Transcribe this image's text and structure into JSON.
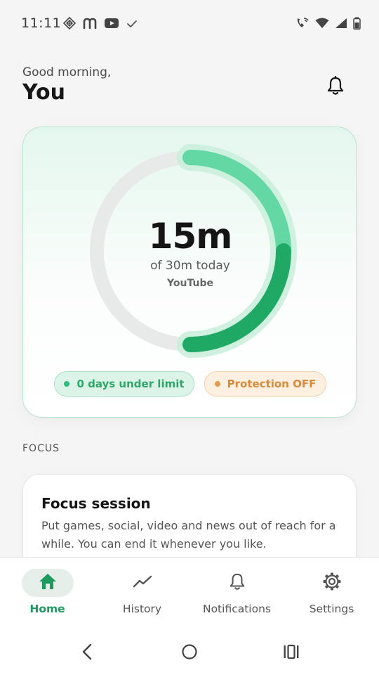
{
  "status_bar": {
    "time": "11:11",
    "left_icons": [
      "diamond-grid-icon",
      "m-app-icon",
      "youtube-icon",
      "check-icon"
    ],
    "right_icons": [
      "wifi-calling-icon",
      "wifi-icon",
      "signal-icon",
      "battery-icon"
    ]
  },
  "header": {
    "greeting": "Good morning,",
    "name": "You",
    "notification_icon": "bell-icon"
  },
  "usage": {
    "value": "15m",
    "subtitle": "of 30m today",
    "app": "YouTube",
    "progress_fraction": 0.5,
    "streak_pill": "0 days under limit",
    "protection_pill": "Protection OFF",
    "colors": {
      "accent": "#2fbf7a",
      "accent_dark": "#1fa766",
      "warning": "#e39a4b"
    }
  },
  "focus": {
    "section_label": "FOCUS",
    "title": "Focus session",
    "description": "Put games, social, video and news out of reach for a while. You can end it whenever you like."
  },
  "bottom_nav": {
    "items": [
      {
        "label": "Home",
        "icon": "home-icon",
        "active": true
      },
      {
        "label": "History",
        "icon": "trend-icon",
        "active": false
      },
      {
        "label": "Notifications",
        "icon": "bell-icon",
        "active": false
      },
      {
        "label": "Settings",
        "icon": "gear-icon",
        "active": false
      }
    ]
  },
  "system_nav": [
    "back-icon",
    "home-circle-icon",
    "recents-icon"
  ]
}
